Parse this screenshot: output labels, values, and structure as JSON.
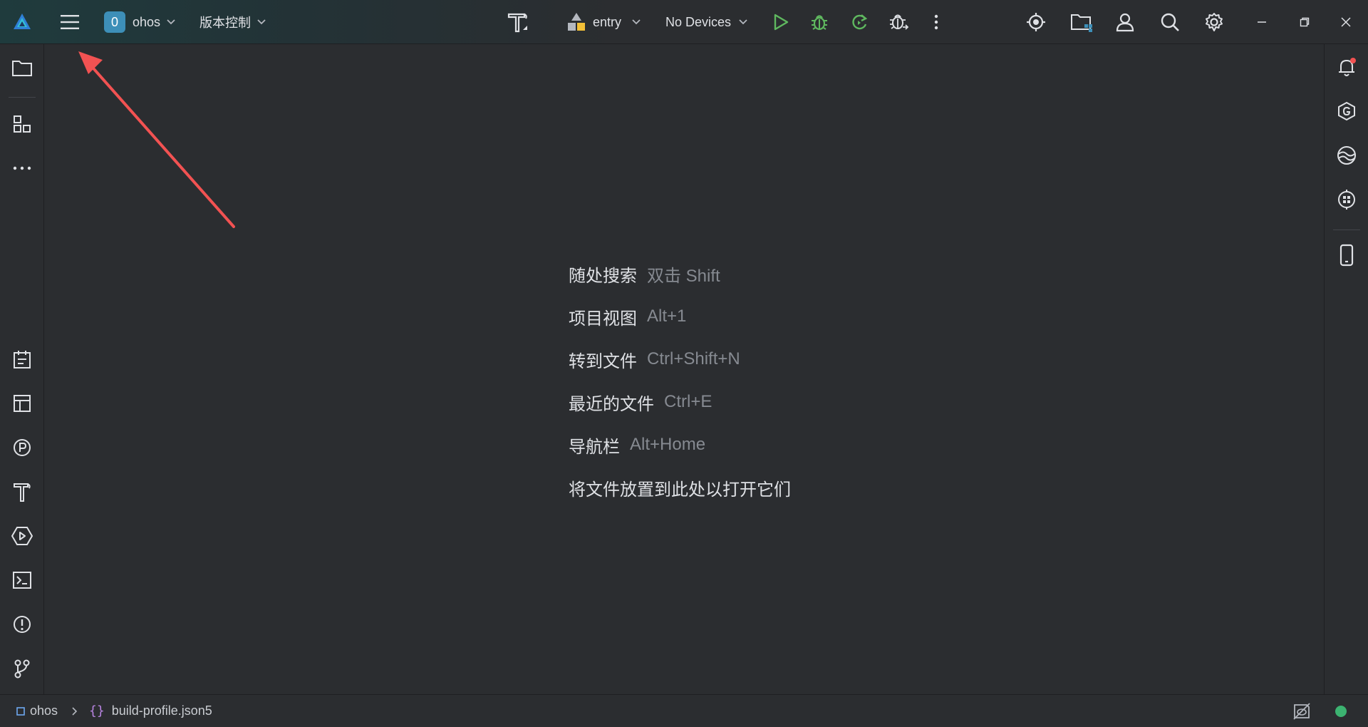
{
  "titlebar": {
    "project_badge": "0",
    "project_name": "ohos",
    "vcs_label": "版本控制",
    "module_name": "entry",
    "device_label": "No Devices"
  },
  "editor": {
    "hints": [
      {
        "label": "随处搜索",
        "key": "双击 Shift"
      },
      {
        "label": "项目视图",
        "key": "Alt+1"
      },
      {
        "label": "转到文件",
        "key": "Ctrl+Shift+N"
      },
      {
        "label": "最近的文件",
        "key": "Ctrl+E"
      },
      {
        "label": "导航栏",
        "key": "Alt+Home"
      },
      {
        "label": "将文件放置到此处以打开它们",
        "key": ""
      }
    ]
  },
  "statusbar": {
    "project": "ohos",
    "file": "build-profile.json5"
  },
  "colors": {
    "run": "#5fb85f",
    "debug": "#5fb85f",
    "accent": "#3d8fb8",
    "annotation_arrow": "#f25252",
    "status_ok": "#3cb371"
  },
  "icons": {
    "left_top": [
      "folder-icon",
      "structure-icon",
      "more-icon"
    ],
    "left_bottom": [
      "todo-icon",
      "layout-icon",
      "profiler-icon",
      "build-icon",
      "run-services-icon",
      "terminal-icon",
      "problems-icon",
      "git-icon"
    ],
    "right": [
      "notifications-icon",
      "gradle-icon",
      "device-sync-icon",
      "app-inspector-icon",
      "device-manager-icon"
    ]
  }
}
